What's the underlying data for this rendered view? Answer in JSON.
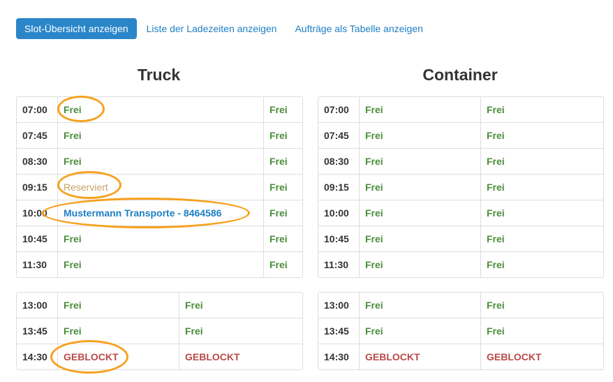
{
  "nav": {
    "active_label": "Slot-Übersicht anzeigen",
    "link_1": "Liste der Ladezeiten anzeigen",
    "link_2": "Aufträge als Tabelle anzeigen"
  },
  "truck": {
    "title": "Truck",
    "morning": [
      {
        "time": "07:00",
        "a": "Frei",
        "b": "Frei"
      },
      {
        "time": "07:45",
        "a": "Frei",
        "b": "Frei"
      },
      {
        "time": "08:30",
        "a": "Frei",
        "b": "Frei"
      },
      {
        "time": "09:15",
        "a": "Reserviert",
        "b": "Frei"
      },
      {
        "time": "10:00",
        "a": "Mustermann Transporte - 8464586",
        "b": "Frei"
      },
      {
        "time": "10:45",
        "a": "Frei",
        "b": "Frei"
      },
      {
        "time": "11:30",
        "a": "Frei",
        "b": "Frei"
      }
    ],
    "afternoon": [
      {
        "time": "13:00",
        "a": "Frei",
        "b": "Frei"
      },
      {
        "time": "13:45",
        "a": "Frei",
        "b": "Frei"
      },
      {
        "time": "14:30",
        "a": "GEBLOCKT",
        "b": "GEBLOCKT"
      }
    ]
  },
  "container": {
    "title": "Container",
    "morning": [
      {
        "time": "07:00",
        "a": "Frei",
        "b": "Frei"
      },
      {
        "time": "07:45",
        "a": "Frei",
        "b": "Frei"
      },
      {
        "time": "08:30",
        "a": "Frei",
        "b": "Frei"
      },
      {
        "time": "09:15",
        "a": "Frei",
        "b": "Frei"
      },
      {
        "time": "10:00",
        "a": "Frei",
        "b": "Frei"
      },
      {
        "time": "10:45",
        "a": "Frei",
        "b": "Frei"
      },
      {
        "time": "11:30",
        "a": "Frei",
        "b": "Frei"
      }
    ],
    "afternoon": [
      {
        "time": "13:00",
        "a": "Frei",
        "b": "Frei"
      },
      {
        "time": "13:45",
        "a": "Frei",
        "b": "Frei"
      },
      {
        "time": "14:30",
        "a": "GEBLOCKT",
        "b": "GEBLOCKT"
      }
    ]
  },
  "colors": {
    "accent": "#2a86c9",
    "free": "#4a8d3a",
    "reserved": "#c7a265",
    "booked": "#1d7fc4",
    "blocked": "#b94a48",
    "highlight": "#f6a11f"
  }
}
